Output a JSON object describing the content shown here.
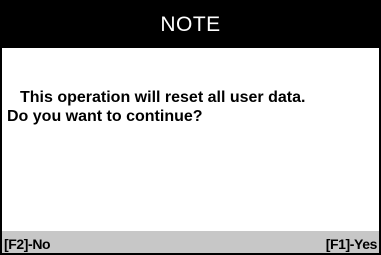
{
  "dialog": {
    "title": "NOTE",
    "message_line1": "This operation will reset all user data.",
    "message_line2": "Do you want to continue?"
  },
  "footer": {
    "left_key": "[F2]-No",
    "right_key": "[F1]-Yes"
  },
  "colors": {
    "title_bar_bg": "#000000",
    "title_text": "#ffffff",
    "body_bg": "#ffffff",
    "footer_bg": "#c7c7c7",
    "text": "#000000"
  }
}
